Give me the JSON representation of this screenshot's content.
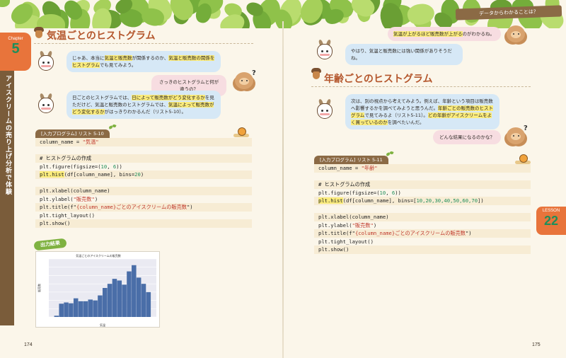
{
  "header": {
    "right_banner": "データからわかることは？"
  },
  "chapter": {
    "label": "Chapter",
    "number": "5",
    "title": "アイスクリームの売り上げ分析で体験"
  },
  "lesson": {
    "label": "LESSON",
    "number": "22"
  },
  "left": {
    "title": "気温ごとのヒストグラム",
    "bubble1_parts": [
      {
        "t": "じゃあ、本当に",
        "h": false
      },
      {
        "t": "気温と販売数",
        "h": true
      },
      {
        "t": "が関係するのか、",
        "h": false
      },
      {
        "t": "気温と販売数の関係をヒストグラム",
        "h": true
      },
      {
        "t": "でも見てみよう。",
        "h": false
      }
    ],
    "bubble2": "さっきのヒストグラムと何が違うの？",
    "bubble3_parts": [
      {
        "t": "日ごとのヒストグラムでは、",
        "h": false
      },
      {
        "t": "日によって販売数がどう変化するか",
        "h": true
      },
      {
        "t": "を見ただけど、気温と販売数のヒストグラムでは、",
        "h": false
      },
      {
        "t": "気温によって販売数がどう変化するか",
        "h": true
      },
      {
        "t": "がはっきりわかるんだ（リスト5-10）。",
        "h": false
      }
    ],
    "listing_label": "[入力プログラム] リスト 5-10",
    "output_label": "出力結果",
    "page_number": "174"
  },
  "right": {
    "bubble1_parts": [
      {
        "t": "気温が上がるほど販売数が上がる",
        "h": true
      },
      {
        "t": "のがわかるね。",
        "h": false
      }
    ],
    "bubble2": "やはり、気温と販売数には強い関係がありそうだね。",
    "title": "年齢ごとのヒストグラム",
    "bubble3_parts": [
      {
        "t": "次は、別の視点から考えてみよう。例えば、年齢という項目は販売数へ影響するかを調べてみようと思うんだ。",
        "h": false
      },
      {
        "t": "年齢ごとの販売数のヒストグラム",
        "h": true
      },
      {
        "t": "で見てみるよ（リスト5-11）。",
        "h": false
      },
      {
        "t": "どの年齢がアイスクリームをよく買っているのか",
        "h": true
      },
      {
        "t": "を調べたいんだ。",
        "h": false
      }
    ],
    "bubble4": "どんな結果になるのかな？",
    "listing_label": "[入力プログラム] リスト 5-11",
    "page_number": "175"
  },
  "code_510": [
    [
      {
        "t": "column_name = "
      },
      {
        "t": "\"気温\"",
        "c": "str"
      }
    ],
    [],
    [
      {
        "t": "# ヒストグラムの作成"
      }
    ],
    [
      {
        "t": "plt.figure(figsize=("
      },
      {
        "t": "10",
        "c": "num"
      },
      {
        "t": ", "
      },
      {
        "t": "6",
        "c": "num"
      },
      {
        "t": "))"
      }
    ],
    [
      {
        "t": "plt.hist",
        "c": "kw-hl"
      },
      {
        "t": "(df[column_name], bins="
      },
      {
        "t": "20",
        "c": "num"
      },
      {
        "t": ")"
      }
    ],
    [],
    [
      {
        "t": "plt.xlabel(column_name)"
      }
    ],
    [
      {
        "t": "plt.ylabel("
      },
      {
        "t": "\"販売数\"",
        "c": "str"
      },
      {
        "t": ")"
      }
    ],
    [
      {
        "t": "plt.title(f\""
      },
      {
        "t": "{column_name}ごとのアイスクリームの販売数",
        "c": "fstr"
      },
      {
        "t": "\")"
      }
    ],
    [
      {
        "t": "plt.tight_layout()"
      }
    ],
    [
      {
        "t": "plt.show()"
      }
    ]
  ],
  "code_511": [
    [
      {
        "t": "column_name = "
      },
      {
        "t": "\"年齢\"",
        "c": "str"
      }
    ],
    [],
    [
      {
        "t": "# ヒストグラムの作成"
      }
    ],
    [
      {
        "t": "plt.figure(figsize=("
      },
      {
        "t": "10",
        "c": "num"
      },
      {
        "t": ", "
      },
      {
        "t": "6",
        "c": "num"
      },
      {
        "t": "))"
      }
    ],
    [
      {
        "t": "plt.hist",
        "c": "kw-hl"
      },
      {
        "t": "(df[column_name], bins=["
      },
      {
        "t": "10,20,30,40,50,60,70",
        "c": "num"
      },
      {
        "t": "])"
      }
    ],
    [],
    [
      {
        "t": "plt.xlabel(column_name)"
      }
    ],
    [
      {
        "t": "plt.ylabel("
      },
      {
        "t": "\"販売数\"",
        "c": "str"
      },
      {
        "t": ")"
      }
    ],
    [
      {
        "t": "plt.title(f\""
      },
      {
        "t": "{column_name}ごとのアイスクリームの販売数",
        "c": "fstr"
      },
      {
        "t": "\")"
      }
    ],
    [
      {
        "t": "plt.tight_layout()"
      }
    ],
    [
      {
        "t": "plt.show()"
      }
    ]
  ],
  "chart_data": {
    "type": "bar",
    "title": "気温ごとのアイスクリームの販売数",
    "xlabel": "気温",
    "ylabel": "販売数",
    "bins": [
      "b1",
      "b2",
      "b3",
      "b4",
      "b5",
      "b6",
      "b7",
      "b8",
      "b9",
      "b10",
      "b11",
      "b12",
      "b13",
      "b14",
      "b15",
      "b16",
      "b17",
      "b18",
      "b19",
      "b20"
    ],
    "values": [
      3,
      32,
      35,
      33,
      45,
      38,
      38,
      42,
      40,
      52,
      70,
      80,
      92,
      88,
      78,
      110,
      125,
      95,
      80,
      60
    ],
    "ylim": [
      0,
      140
    ],
    "bar_color": "#4a6ea8",
    "grid": true
  }
}
